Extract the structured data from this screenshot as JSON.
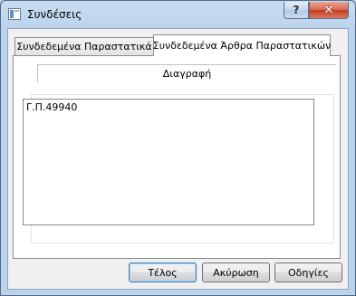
{
  "window": {
    "title": "Συνδέσεις",
    "help_glyph": "?",
    "close_glyph": "✕"
  },
  "tabs": [
    {
      "label": "Συνδεδεμένα Παραστατικά",
      "active": false
    },
    {
      "label": "Συνδεδεμένα Άρθρα Παραστατικών",
      "active": true
    }
  ],
  "panel": {
    "subtab_label": "Διαγραφή",
    "list_items": [
      "Γ.Π.49940"
    ]
  },
  "buttons": {
    "finish": "Τέλος",
    "cancel": "Ακύρωση",
    "help": "Οδηγίες"
  },
  "icons": {
    "app": "app-window-icon",
    "help": "help-icon",
    "close": "close-icon"
  }
}
